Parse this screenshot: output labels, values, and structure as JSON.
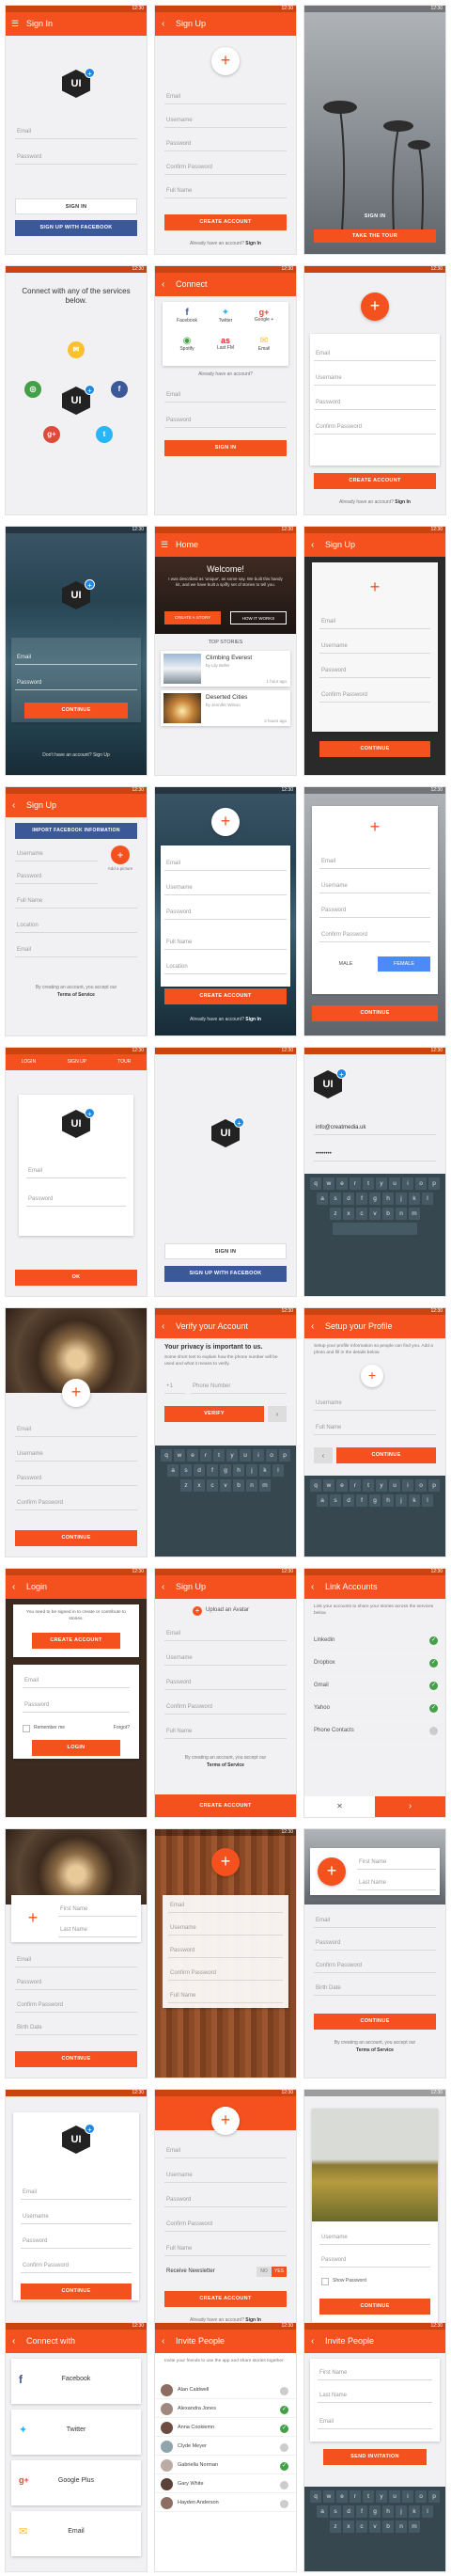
{
  "status": {
    "time": "12:30"
  },
  "signin1": {
    "title": "Sign In",
    "logo": "UI",
    "badge": "+",
    "email": "Email",
    "password": "Password",
    "signin_btn": "SIGN IN",
    "fb_btn": "SIGN UP WITH FACEBOOK"
  },
  "signup1": {
    "title": "Sign Up",
    "email": "Email",
    "username": "Username",
    "password": "Password",
    "confirm": "Confirm Password",
    "fullname": "Full Name",
    "create_btn": "CREATE ACCOUNT",
    "have_account": "Already have an account?",
    "signin_link": "Sign In"
  },
  "palm": {
    "signin": "SIGN IN",
    "take_tour": "TAKE THE TOUR"
  },
  "connect1": {
    "heading": "Connect with any of the services below."
  },
  "connect2": {
    "title": "Connect",
    "services": [
      "Facebook",
      "Twitter",
      "Google +",
      "Spotify",
      "Last FM",
      "Email"
    ],
    "have_account": "Already have an account?",
    "email": "Email",
    "password": "Password",
    "signin_btn": "SIGN IN"
  },
  "signup2": {
    "email": "Email",
    "username": "Username",
    "password": "Password",
    "confirm": "Confirm Password",
    "create_btn": "CREATE ACCOUNT",
    "have_account": "Already have an account?",
    "signin_link": "Sign In"
  },
  "sea1": {
    "email": "Email",
    "password": "Password",
    "continue_btn": "CONTINUE",
    "footer": "Don't have an account? Sign Up"
  },
  "home": {
    "title": "Home",
    "welcome": "Welcome!",
    "intro": "I was described as 'unique', as some say. We built this handy kit, and we have built a spiffy set of stories to tell you.",
    "create_btn": "CREATE A STORY",
    "how_btn": "HOW IT WORKS",
    "top": "TOP STORIES",
    "stories": [
      {
        "title": "Climbing Everest",
        "by": "by Lily Beller",
        "time": "1 hour ago"
      },
      {
        "title": "Deserted Cities",
        "by": "by Jennifer Wilson",
        "time": "2 hours ago"
      }
    ]
  },
  "signup3": {
    "title": "Sign Up",
    "email": "Email",
    "username": "Username",
    "password": "Password",
    "confirm": "Confirm Password",
    "continue_btn": "CONTINUE"
  },
  "signup4": {
    "title": "Sign Up",
    "import_btn": "IMPORT FACEBOOK INFORMATION",
    "username": "Username",
    "password": "Password",
    "fullname": "Full Name",
    "location": "Location",
    "email": "Email",
    "add_photo": "Add a picture",
    "terms_text": "By creating an account, you accept our",
    "terms_link": "Terms of Service"
  },
  "signup5": {
    "email": "Email",
    "username": "Username",
    "password": "Password",
    "fullname": "Full Name",
    "location": "Location",
    "create_btn": "CREATE ACCOUNT",
    "have_account": "Already have an account?",
    "signin_link": "Sign In"
  },
  "signup6": {
    "email": "Email",
    "username": "Username",
    "password": "Password",
    "confirm": "Confirm Password",
    "male": "MALE",
    "female": "FEMALE",
    "continue_btn": "CONTINUE"
  },
  "tabs": {
    "items": [
      "LOGIN",
      "SIGN UP",
      "TOUR"
    ],
    "email": "Email",
    "password": "Password",
    "ok_btn": "OK"
  },
  "signin2": {
    "signin_btn": "SIGN IN",
    "fb_btn": "SIGN UP WITH FACEBOOK"
  },
  "kbd": {
    "email": "info@creatmedia.uk",
    "password": "••••••••",
    "rows": [
      [
        "q",
        "w",
        "e",
        "r",
        "t",
        "y",
        "u",
        "i",
        "o",
        "p"
      ],
      [
        "a",
        "s",
        "d",
        "f",
        "g",
        "h",
        "j",
        "k",
        "l"
      ],
      [
        "z",
        "x",
        "c",
        "v",
        "b",
        "n",
        "m"
      ]
    ]
  },
  "arch1": {
    "email": "Email",
    "username": "Username",
    "password": "Password",
    "confirm": "Confirm Password",
    "continue_btn": "CONTINUE"
  },
  "verify": {
    "title": "Verify your Account",
    "heading": "Your privacy is important to us.",
    "body": "Some short text to explain how the phone number will be used and what it means to verify.",
    "code": "+1",
    "phone": "Phone Number",
    "verify_btn": "VERIFY"
  },
  "profile": {
    "title": "Setup your Profile",
    "body": "Setup your profile information so people can find you. Add a photo and fill in the details below.",
    "username": "Username",
    "fullname": "Full Name",
    "continue_btn": "CONTINUE"
  },
  "login": {
    "title": "Login",
    "notice": "You need to be signed in to create or contribute to stories.",
    "create_btn": "CREATE ACCOUNT",
    "email": "Email",
    "password": "Password",
    "remember": "Remember me",
    "forgot": "Forgot?",
    "login_btn": "LOGIN"
  },
  "signup7": {
    "title": "Sign Up",
    "upload": "Upload an Avatar",
    "email": "Email",
    "username": "Username",
    "password": "Password",
    "confirm": "Confirm Password",
    "fullname": "Full Name",
    "terms_text": "By creating an account, you accept our",
    "terms_link": "Terms of Service",
    "create_btn": "CREATE ACCOUNT"
  },
  "link": {
    "title": "Link Accounts",
    "body": "Link your accounts to share your stories across the services below.",
    "items": [
      "Linkedin",
      "Dropbox",
      "Gmail",
      "Yahoo",
      "Phone Contacts"
    ],
    "states": [
      true,
      true,
      true,
      true,
      false
    ],
    "cancel": "✕",
    "next": "›"
  },
  "arch2": {
    "first": "First Name",
    "last": "Last Name",
    "email": "Email",
    "password": "Password",
    "confirm": "Confirm Password",
    "birth": "Birth Date",
    "continue_btn": "CONTINUE"
  },
  "wood1": {
    "email": "Email",
    "username": "Username",
    "password": "Password",
    "confirm": "Confirm Password",
    "fullname": "Full Name"
  },
  "palm2": {
    "first": "First Name",
    "last": "Last Name",
    "email": "Email",
    "password": "Password",
    "confirm": "Confirm Password",
    "birth": "Birth Date",
    "continue_btn": "CONTINUE",
    "terms_text": "By creating an account, you accept our",
    "terms_link": "Terms of Service"
  },
  "signup8": {
    "email": "Email",
    "username": "Username",
    "password": "Password",
    "confirm": "Confirm Password",
    "continue_btn": "CONTINUE"
  },
  "signup9": {
    "email": "Email",
    "username": "Username",
    "password": "Password",
    "confirm": "Confirm Password",
    "fullname": "Full Name",
    "newsletter": "Receive Newsletter",
    "no": "NO",
    "yes": "YES",
    "create_btn": "CREATE ACCOUNT",
    "have_account": "Already have an account?",
    "signin_link": "Sign In"
  },
  "field1": {
    "username": "Username",
    "password": "Password",
    "show": "Show Password",
    "continue_btn": "CONTINUE"
  },
  "connect3": {
    "title": "Connect with",
    "services": [
      "Facebook",
      "Twitter",
      "Google Plus",
      "Email"
    ]
  },
  "invite": {
    "title": "Invite People",
    "body": "Invite your friends to use the app and share stories together.",
    "people": [
      "Alan Caldwell",
      "Alexandra Jones",
      "Anna Cookiemn",
      "Clyde Meyer",
      "Gabriella Norman",
      "Gary White",
      "Hayden Anderson"
    ],
    "states": [
      false,
      true,
      true,
      false,
      true,
      false,
      false
    ]
  },
  "invite2": {
    "title": "Invite People",
    "first": "First Name",
    "last": "Last Name",
    "email": "Email",
    "send_btn": "SEND INVITATION"
  }
}
